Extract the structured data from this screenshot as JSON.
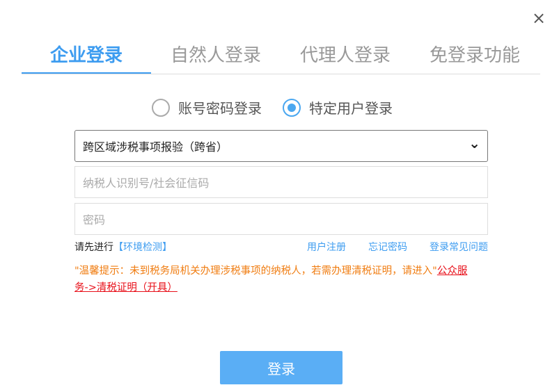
{
  "close_icon": "×",
  "tabs": [
    "企业登录",
    "自然人登录",
    "代理人登录",
    "免登录功能"
  ],
  "radios": [
    {
      "label": "账号密码登录",
      "checked": false
    },
    {
      "label": "特定用户登录",
      "checked": true
    }
  ],
  "select": {
    "value": "跨区域涉税事项报验（跨省）",
    "chevron": "⌄"
  },
  "inputs": {
    "taxid_placeholder": "纳税人识别号/社会征信码",
    "password_placeholder": "密码"
  },
  "links": {
    "prefix": "请先进行",
    "env_check": "【环境检测】",
    "register": "用户注册",
    "forgot": "忘记密码",
    "faq": "登录常见问题"
  },
  "warning": {
    "text": "\"温馨提示：未到税务局机关办理涉税事项的纳税人，若需办理清税证明，请进入\"",
    "link": "公众服务->清税证明（开具）"
  },
  "login_button": "登录",
  "colors": {
    "accent": "#3d9cf0",
    "warning": "#f07d12",
    "link_red": "#e8101a"
  }
}
